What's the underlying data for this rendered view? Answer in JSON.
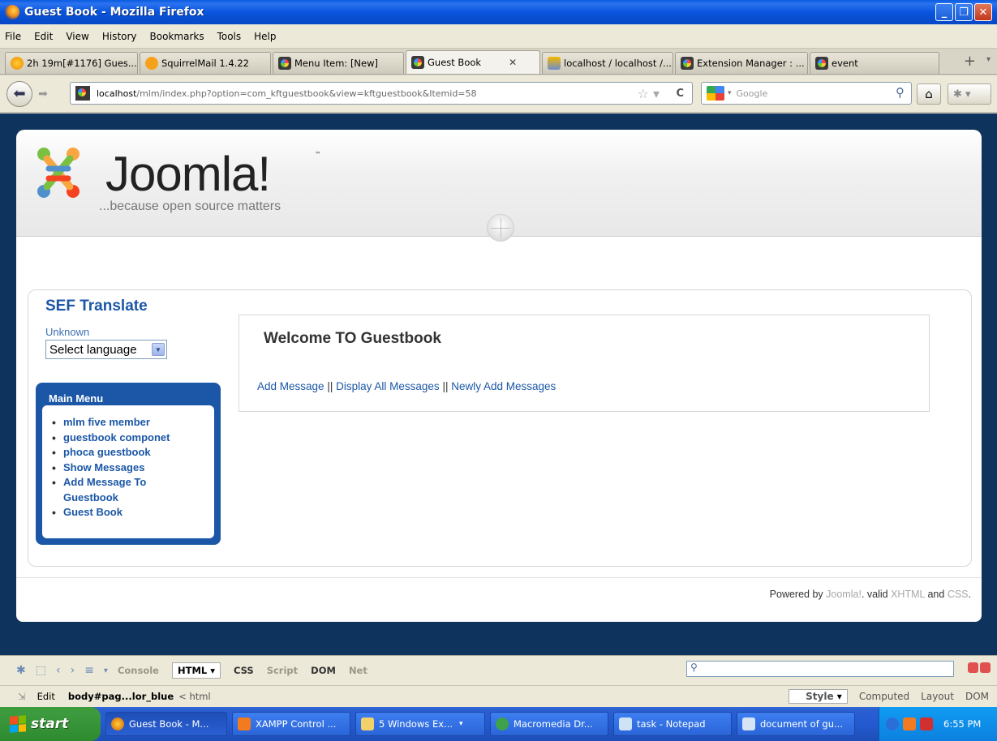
{
  "window": {
    "title": "Guest Book - Mozilla Firefox"
  },
  "menubar": {
    "items": [
      "File",
      "Edit",
      "View",
      "History",
      "Bookmarks",
      "Tools",
      "Help"
    ]
  },
  "tabs": [
    {
      "label": "2h 19m[#1176] Gues...",
      "icon": "clock-icon"
    },
    {
      "label": "SquirrelMail 1.4.22",
      "icon": "cpanel-icon"
    },
    {
      "label": "Menu Item: [New]",
      "icon": "joomla-icon"
    },
    {
      "label": "Guest Book",
      "icon": "joomla-icon",
      "active": true
    },
    {
      "label": "localhost / localhost /...",
      "icon": "phpmyadmin-icon"
    },
    {
      "label": "Extension Manager : ...",
      "icon": "joomla-icon"
    },
    {
      "label": "event",
      "icon": "joomla-icon"
    }
  ],
  "navbar": {
    "url_host": "localhost",
    "url_path": "/mlm/index.php?option=com_kftguestbook&view=kftguestbook&Itemid=58",
    "search_placeholder": "Google"
  },
  "page": {
    "logo_word": "Joomla!",
    "logo_tagline": "...because open source matters",
    "sef_title": "SEF Translate",
    "sef_unknown": "Unknown",
    "language_select": "Select language",
    "main_menu_title": "Main Menu",
    "main_menu_items": [
      "mlm five member",
      "guestbook componet",
      "phoca guestbook",
      "Show Messages",
      "Add Message To Guestbook",
      "Guest Book"
    ],
    "welcome_title": "Welcome TO Guestbook",
    "links": {
      "add": "Add Message",
      "display_all": "Display All Messages",
      "newly": "Newly Add Messages",
      "sep": "||"
    },
    "footer": {
      "powered_by": "Powered by",
      "joomla": "Joomla!",
      "valid": ". valid",
      "xhtml": "XHTML",
      "and": "and",
      "css": "CSS",
      "end": "."
    }
  },
  "firebug": {
    "tabs": [
      "Console",
      "HTML",
      "CSS",
      "Script",
      "DOM",
      "Net"
    ],
    "active_tab": "HTML",
    "edit": "Edit",
    "crumb_body": "body#pag...lor_blue",
    "crumb_html": "< html",
    "side_tabs": [
      "Style",
      "Computed",
      "Layout",
      "DOM"
    ]
  },
  "taskbar": {
    "start": "start",
    "tasks": [
      "Guest Book - M...",
      "XAMPP Control ...",
      "5 Windows Ex...",
      "Macromedia Dr...",
      "task - Notepad",
      "document of gu..."
    ],
    "clock": "6:55 PM"
  },
  "colors": {
    "joomla_blue": "#1b57a6",
    "page_bg": "#0e335c",
    "title_bar": "#0855dd",
    "start_green": "#3c9b3c"
  }
}
